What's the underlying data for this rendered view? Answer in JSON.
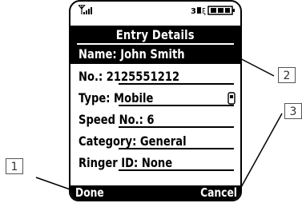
{
  "screen": {
    "title": "Entry Details",
    "rows": [
      {
        "label": "Name: John Smith",
        "selected": true
      },
      {
        "label": "No.: 2125551212"
      },
      {
        "label": "Type: Mobile"
      },
      {
        "label": "Speed No.: 6"
      },
      {
        "label": "Category: General"
      },
      {
        "label": "Ringer ID: None"
      }
    ],
    "softkeys": {
      "left": "Done",
      "right": "Cancel"
    }
  },
  "callouts": {
    "one": "1",
    "two": "2",
    "three": "3"
  }
}
